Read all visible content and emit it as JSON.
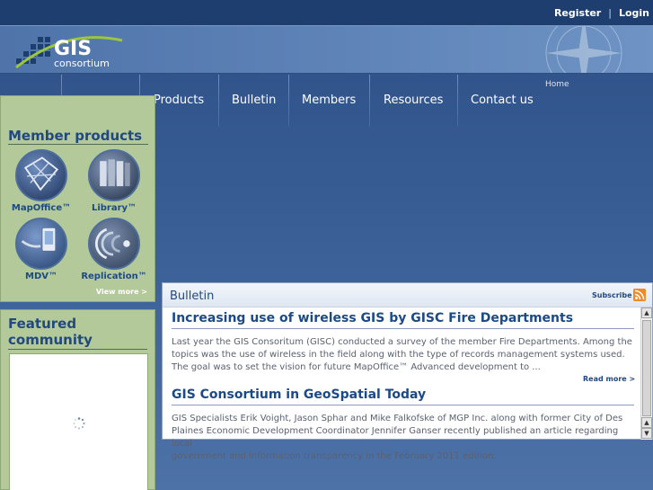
{
  "topbar": {
    "register": "Register",
    "separator": "|",
    "login": "Login"
  },
  "header": {
    "logo_main": "GIS",
    "logo_sub": "consortium"
  },
  "nav": {
    "home": "Home",
    "items": [
      "Products",
      "Bulletin",
      "Members",
      "Resources",
      "Contact us"
    ]
  },
  "member_products": {
    "title": "Member products",
    "products": [
      {
        "label": "MapOffice™",
        "icon": "mapoffice-icon"
      },
      {
        "label": "Library™",
        "icon": "library-icon"
      },
      {
        "label": "MDV™",
        "icon": "mdv-icon"
      },
      {
        "label": "Replication™",
        "icon": "replication-icon"
      }
    ],
    "view_more": "View more >"
  },
  "featured": {
    "title_line1": "Featured",
    "title_line2": "community"
  },
  "bulletin": {
    "title": "Bulletin",
    "subscribe": "Subscribe",
    "articles": [
      {
        "title": "Increasing use of wireless GIS by GISC Fire Departments",
        "line1": "Last year the GIS Consoritum (GISC) conducted a survey of the member Fire Departments. Among the",
        "line2": "topics was the use of wireless in the field along with the type of records management systems used.",
        "line3": "The goal was to set the vision for future MapOffice™ Advanced development to ...",
        "read_more": "Read more >"
      },
      {
        "title": "GIS Consortium in GeoSpatial Today",
        "line1": "GIS Specialists Erik Voight, Jason Sphar and Mike Falkofske of MGP Inc. along with former City of Des",
        "line2": "Plaines Economic Development Coordinator Jennifer Ganser recently published an article regarding local",
        "line3": "government and information transparency in the February 2011 edition."
      }
    ]
  },
  "colors": {
    "accent": "#1c4a86",
    "panel": "#b3c99a",
    "topbar": "#1f3e70",
    "rss": "#f08a24"
  }
}
